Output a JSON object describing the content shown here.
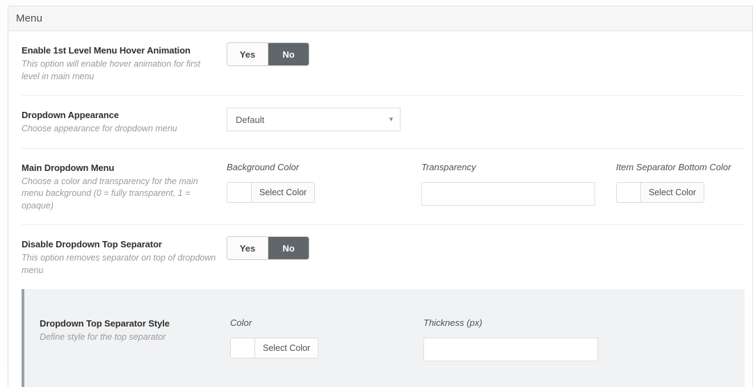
{
  "panel": {
    "header_title": "Menu"
  },
  "options": [
    {
      "id": "enable-hover-animation",
      "title": "Enable 1st Level Menu Hover Animation",
      "description": "This option will enable hover animation for first level in main menu",
      "control": "toggle",
      "toggle": {
        "yes_label": "Yes",
        "no_label": "No",
        "selected": "No"
      }
    },
    {
      "id": "dropdown-appearance",
      "title": "Dropdown Appearance",
      "description": "Choose appearance for dropdown menu",
      "control": "select",
      "select": {
        "value": "Default",
        "caret": "▼"
      }
    },
    {
      "id": "main-dropdown-menu",
      "title": "Main Dropdown Menu",
      "description": "Choose a color and transparency for the main menu background (0 = fully transparent, 1 = opaque)",
      "control": "fields",
      "fields": [
        {
          "label": "Background Color",
          "type": "color",
          "button_label": "Select Color",
          "swatch_color": "#ffffff",
          "value": ""
        },
        {
          "label": "Transparency",
          "type": "text",
          "value": "",
          "placeholder": ""
        },
        {
          "label": "Item Separator Bottom Color",
          "type": "color",
          "button_label": "Select Color",
          "swatch_color": "#ffffff",
          "value": ""
        }
      ]
    },
    {
      "id": "disable-dropdown-top-separator",
      "title": "Disable Dropdown Top Separator",
      "description": "This option removes separator on top of dropdown menu",
      "control": "toggle",
      "toggle": {
        "yes_label": "Yes",
        "no_label": "No",
        "selected": "No"
      }
    }
  ],
  "subpanel": {
    "id": "dropdown-top-separator-style",
    "title": "Dropdown Top Separator Style",
    "description": "Define style for the top separator",
    "accent_color": "#9aa0a6",
    "background_color": "#f1f2f4",
    "fields": [
      {
        "label": "Color",
        "type": "color",
        "button_label": "Select Color",
        "swatch_color": "#ffffff",
        "value": ""
      },
      {
        "label": "Thickness (px)",
        "type": "text",
        "value": "",
        "placeholder": ""
      }
    ]
  },
  "colors": {
    "panel_header_bg": "#f6f6f6",
    "toggle_active_bg": "#61666b",
    "title_text": "#2f2f2f",
    "desc_text": "#9b9b9b",
    "divider": "#ededed"
  }
}
